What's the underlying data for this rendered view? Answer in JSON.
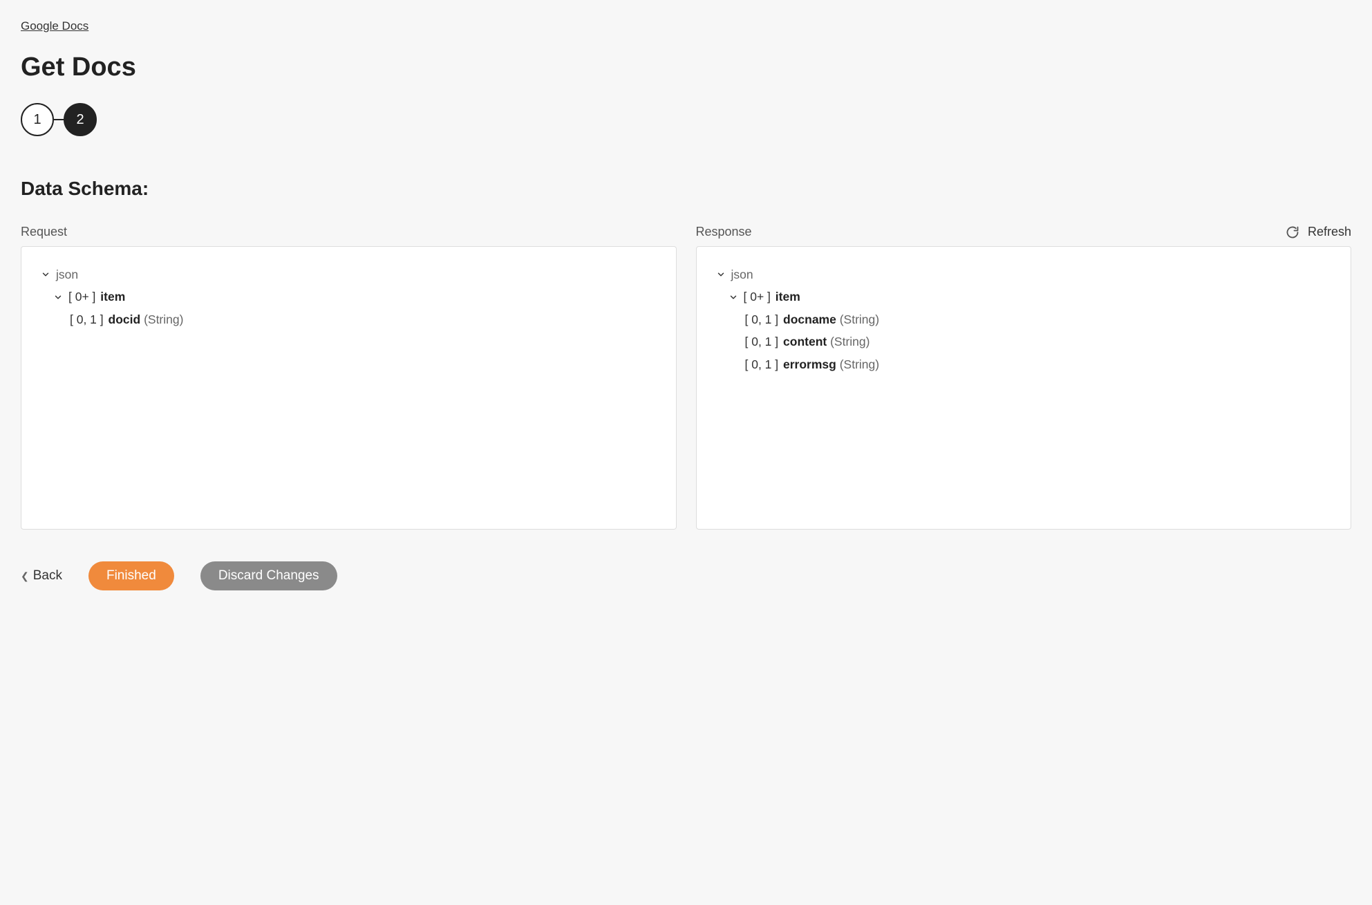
{
  "breadcrumb": {
    "label": "Google Docs"
  },
  "page_title": "Get Docs",
  "stepper": {
    "step1": "1",
    "step2": "2"
  },
  "section_title": "Data Schema:",
  "refresh_label": "Refresh",
  "request": {
    "header": "Request",
    "root": "json",
    "item_prefix": "[ 0+ ]",
    "item_name": "item",
    "fields": [
      {
        "cardinality": "[ 0, 1 ]",
        "name": "docid",
        "type": "(String)"
      }
    ]
  },
  "response": {
    "header": "Response",
    "root": "json",
    "item_prefix": "[ 0+ ]",
    "item_name": "item",
    "fields": [
      {
        "cardinality": "[ 0, 1 ]",
        "name": "docname",
        "type": "(String)"
      },
      {
        "cardinality": "[ 0, 1 ]",
        "name": "content",
        "type": "(String)"
      },
      {
        "cardinality": "[ 0, 1 ]",
        "name": "errormsg",
        "type": "(String)"
      }
    ]
  },
  "footer": {
    "back": "Back",
    "finished": "Finished",
    "discard": "Discard Changes"
  }
}
